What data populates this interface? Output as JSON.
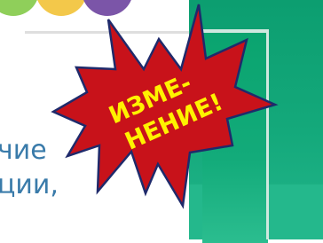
{
  "slide": {
    "body_lines": [
      "чие",
      "ции,"
    ],
    "starburst_text": [
      "ИЗМЕ-",
      "НЕНИЕ!"
    ]
  },
  "colors": {
    "starburst_fill": "#c8121a",
    "starburst_stroke": "#1f2a6b",
    "starburst_text": "#fff200",
    "panel": "#14a97b",
    "body_text": "#3a7baa"
  }
}
